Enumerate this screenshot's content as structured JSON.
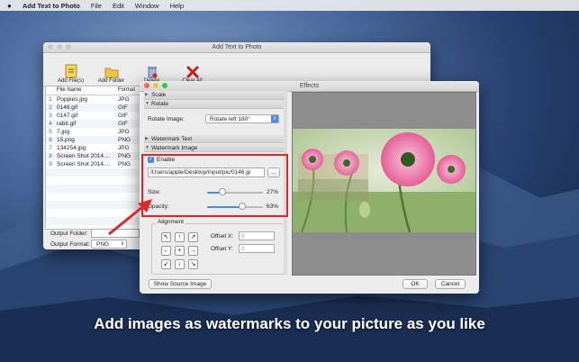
{
  "menubar": {
    "apple_icon": "apple-icon",
    "app_name": "Add Text to Photo",
    "items": [
      "File",
      "Edit",
      "Window",
      "Help"
    ]
  },
  "main_window": {
    "title": "Add Text to Photo",
    "toolbar": [
      {
        "label": "Add File(s)",
        "icon": "add-file-icon",
        "color": "#d8a21a"
      },
      {
        "label": "Add Folder",
        "icon": "add-folder-icon",
        "color": "#e5b52a"
      },
      {
        "label": "Delete",
        "icon": "delete-icon",
        "color": "#7a98c0"
      },
      {
        "label": "Clear All",
        "icon": "clear-all-icon",
        "color": "#c81e1e"
      }
    ],
    "list_headers": [
      "File Name",
      "Format"
    ],
    "files": [
      {
        "n": "1",
        "name": "Poppies.jpg",
        "fmt": "JPG"
      },
      {
        "n": "2",
        "name": "0146.gif",
        "fmt": "GIF"
      },
      {
        "n": "3",
        "name": "0147.gif",
        "fmt": "GIF"
      },
      {
        "n": "4",
        "name": "rabit.gif",
        "fmt": "GIF"
      },
      {
        "n": "5",
        "name": "7.jpg",
        "fmt": "JPG"
      },
      {
        "n": "6",
        "name": "15.png",
        "fmt": "PNG"
      },
      {
        "n": "7",
        "name": "134254.jpg",
        "fmt": "JPG"
      },
      {
        "n": "8",
        "name": "Screen Shot 2014....",
        "fmt": "PNG"
      },
      {
        "n": "9",
        "name": "Screen Shot 2014....",
        "fmt": "PNG"
      }
    ],
    "output_folder_label": "Output Folder:",
    "output_format_label": "Output Format:",
    "output_format_value": "PNG"
  },
  "effects": {
    "title": "Effects",
    "sections": {
      "scale": "Scale",
      "rotate": "Rotate",
      "watermark_text": "Watermark Text",
      "watermark_image": "Watermark Image"
    },
    "rotate_label": "Rotate Image:",
    "rotate_value": "Rotate left 180°",
    "enable_label": "Enable",
    "path_value": "/Users/apple/Desktop/input/pic/0146.jp",
    "browse_label": "...",
    "size_label": "Size:",
    "size_value": "27%",
    "size_level": 0.27,
    "opacity_label": "Opacity:",
    "opacity_value": "63%",
    "opacity_level": 0.63,
    "alignment_label": "Alignment",
    "alignment_arrows": [
      "↖",
      "↑",
      "↗",
      "←",
      "•",
      "→",
      "↙",
      "↓",
      "↘"
    ],
    "offset_x_label": "Offset X:",
    "offset_x_value": "0",
    "offset_y_label": "Offset Y:",
    "offset_y_value": "0",
    "show_source_label": "Show Source Image",
    "ok_label": "OK",
    "cancel_label": "Cancel"
  },
  "caption": "Add images as watermarks to your picture as you like",
  "colors": {
    "highlight_box": "#e0262a",
    "accent": "#4a8be0"
  }
}
